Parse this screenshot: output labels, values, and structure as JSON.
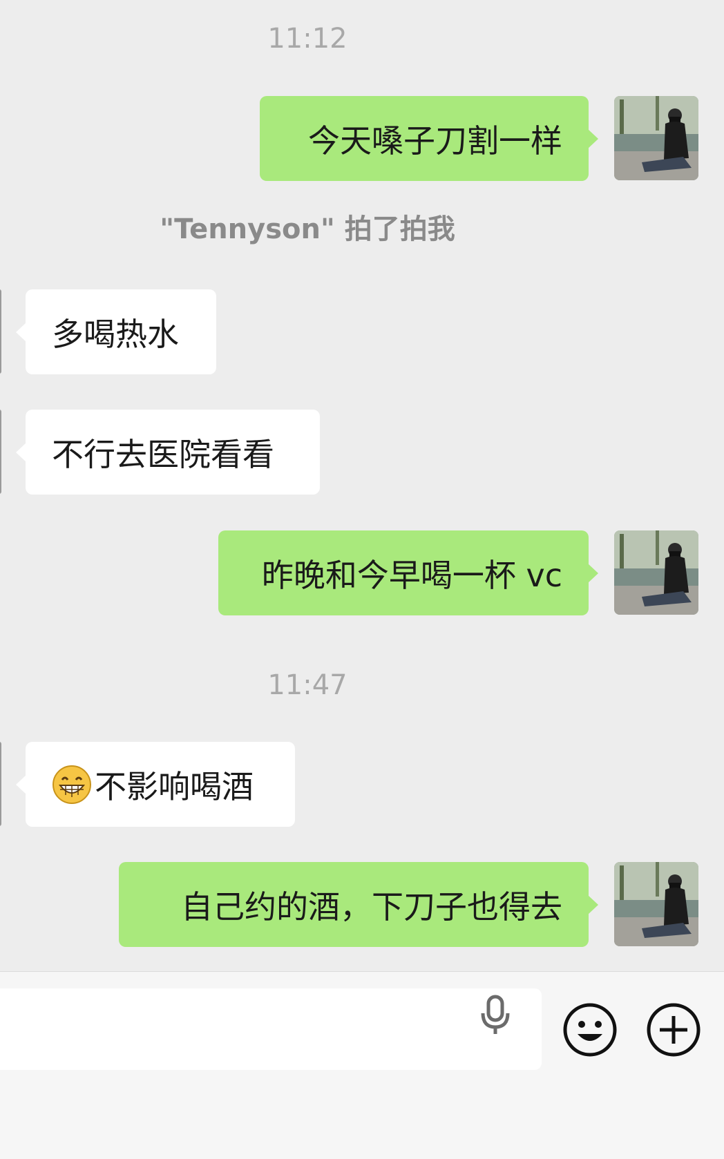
{
  "chat": {
    "timestamps": [
      "11:12",
      "11:47"
    ],
    "system_note": "\"Tennyson\" 拍了拍我",
    "messages": [
      {
        "side": "out",
        "text": "今天嗓子刀割一样"
      },
      {
        "side": "in",
        "text": "多喝热水"
      },
      {
        "side": "in",
        "text": "不行去医院看看"
      },
      {
        "side": "out",
        "text": "昨晚和今早喝一杯 vc"
      },
      {
        "side": "in",
        "text": "不影响喝酒",
        "emoji": "grinning-face-emoji"
      },
      {
        "side": "out",
        "text": "自己约的酒，下刀子也得去"
      }
    ]
  },
  "input_bar": {
    "text_value": "",
    "icons": [
      "microphone-icon",
      "emoji-face-icon",
      "plus-circle-icon"
    ]
  },
  "colors": {
    "background": "#ededed",
    "outgoing_bubble": "#a9e97c",
    "incoming_bubble": "#ffffff",
    "timestamp_text": "#a8a8a8",
    "input_bar_background": "#f6f6f6"
  }
}
